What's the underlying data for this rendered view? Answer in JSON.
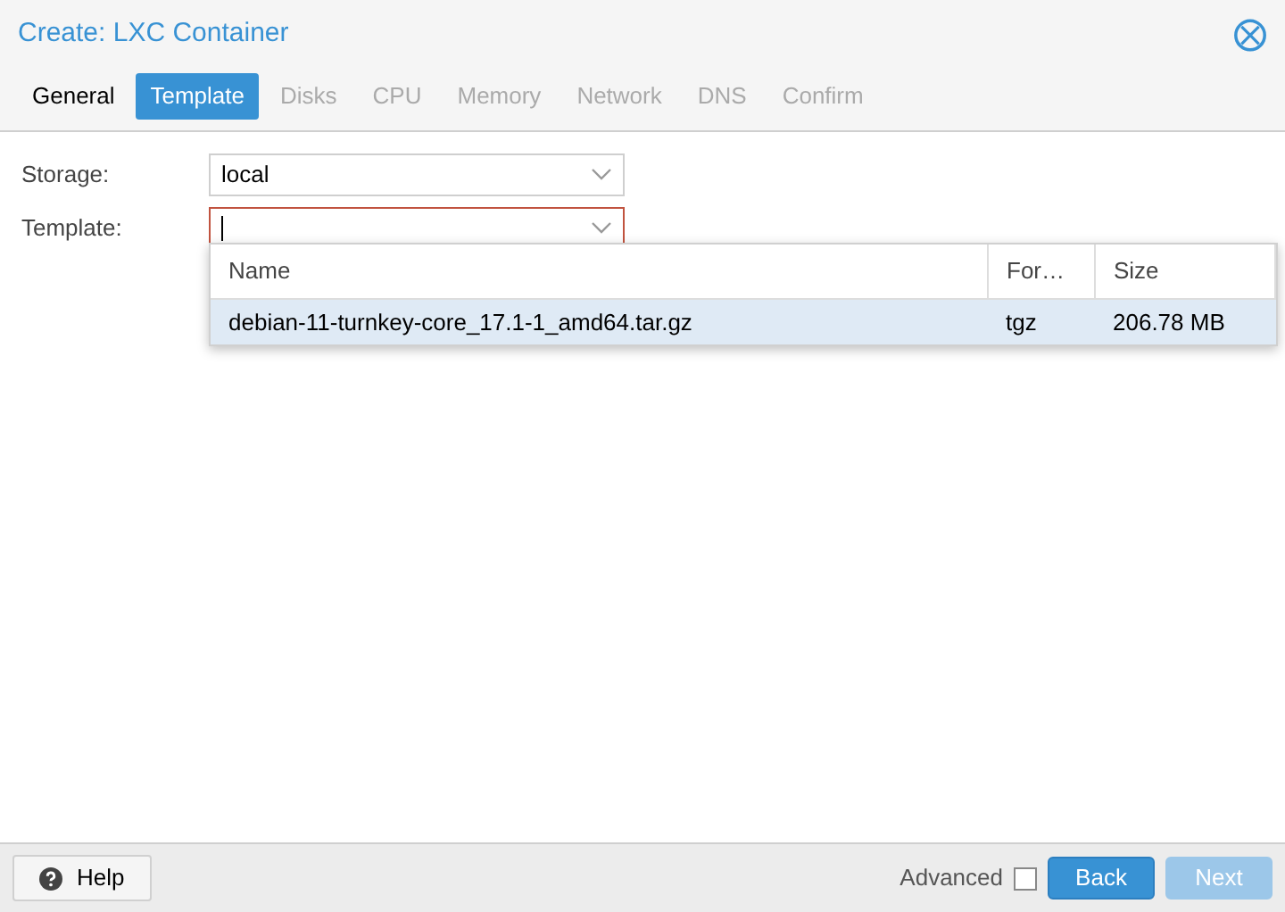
{
  "window": {
    "title": "Create: LXC Container",
    "close_label": "⨂"
  },
  "tabs": [
    {
      "label": "General",
      "selected": false,
      "disabled": false
    },
    {
      "label": "Template",
      "selected": true,
      "disabled": false
    },
    {
      "label": "Disks",
      "selected": false,
      "disabled": true
    },
    {
      "label": "CPU",
      "selected": false,
      "disabled": true
    },
    {
      "label": "Memory",
      "selected": false,
      "disabled": true
    },
    {
      "label": "Network",
      "selected": false,
      "disabled": true
    },
    {
      "label": "DNS",
      "selected": false,
      "disabled": true
    },
    {
      "label": "Confirm",
      "selected": false,
      "disabled": true
    }
  ],
  "fields": [
    {
      "label": "Storage:",
      "value": "local",
      "invalid": false
    },
    {
      "label": "Template:",
      "invalid": true,
      "focused": true
    }
  ],
  "dropdown": {
    "columns": [
      "Name",
      "For…",
      "Size"
    ],
    "rows": [
      {
        "cells": [
          "debian-11-turnkey-core_17.1-1_amd64.tar.gz",
          "tgz",
          "206.78 MB"
        ],
        "selected": true
      }
    ]
  },
  "footer": {
    "help": "Help",
    "advanced": {
      "label": "Advanced",
      "checked": false
    },
    "buttons": [
      {
        "label": "Back",
        "disabled": false
      },
      {
        "label": "Next",
        "disabled": true
      }
    ]
  }
}
